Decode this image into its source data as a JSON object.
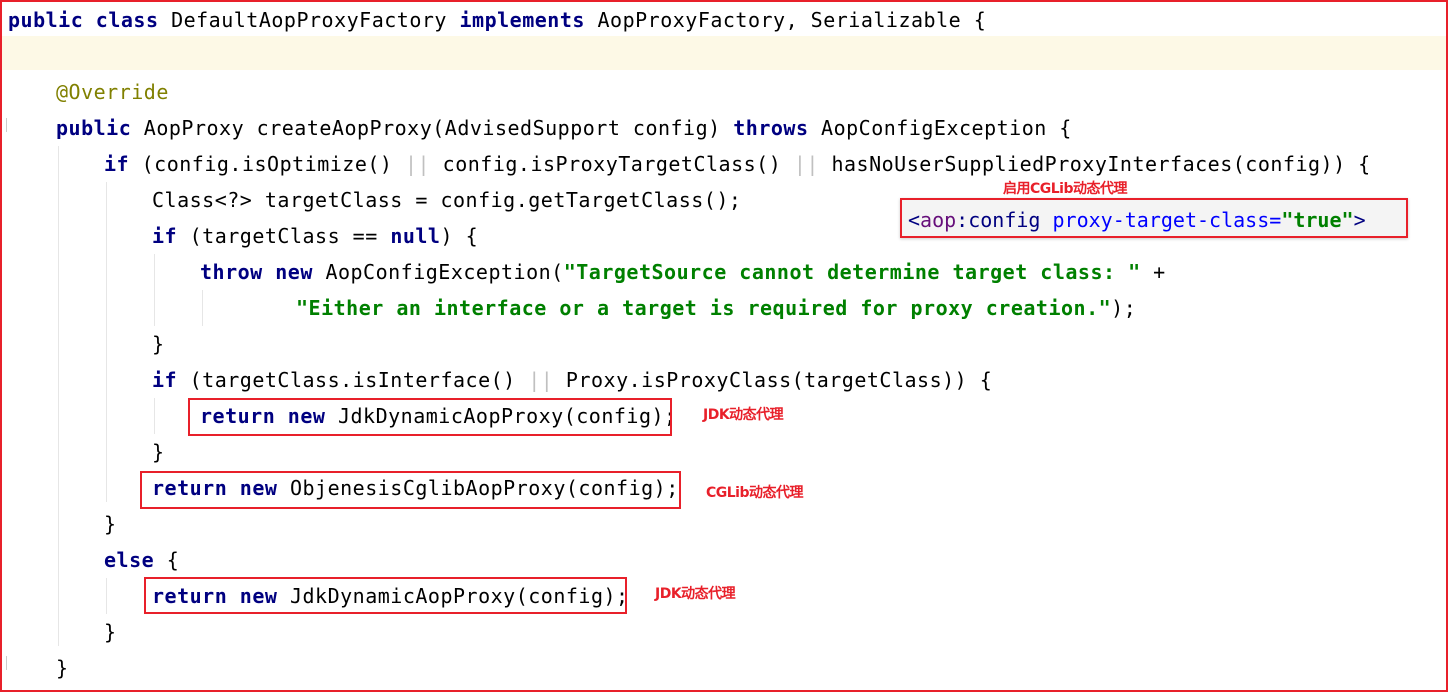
{
  "code": {
    "class_decl": {
      "kw1": "public",
      "kw2": "class",
      "name": "DefaultAopProxyFactory",
      "kw3": "implements",
      "rest": "AopProxyFactory, Serializable {"
    },
    "annotation": "@Override",
    "method_decl": {
      "kw": "public",
      "sig": "AopProxy createAopProxy(AdvisedSupport config)",
      "throws": "throws",
      "rest": "AopConfigException {"
    },
    "if1": {
      "kw": "if",
      "p1": "(config.isOptimize()",
      "p2": "config.isProxyTargetClass()",
      "p3": "hasNoUserSuppliedProxyInterfaces(config)) {",
      "or": "||"
    },
    "target_class": "Class<?> targetClass = config.getTargetClass();",
    "if2": {
      "kw": "if",
      "cond": "(targetClass ==",
      "null": "null",
      "rest": ") {"
    },
    "throw_line": {
      "kw1": "throw",
      "kw2": "new",
      "call": "AopConfigException(",
      "str": "\"TargetSource cannot determine target class: \"",
      "rest": " +"
    },
    "throw_line2": {
      "str": "\"Either an interface or a target is required for proxy creation.\"",
      "rest": ");"
    },
    "close_brace": "}",
    "if3": {
      "kw": "if",
      "p1": "(targetClass.isInterface()",
      "or": "||",
      "p2": "Proxy.isProxyClass(targetClass)) {"
    },
    "return_jdk": {
      "kw1": "return",
      "kw2": "new",
      "rest": "JdkDynamicAopProxy(config);"
    },
    "return_cglib": {
      "kw1": "return",
      "kw2": "new",
      "rest": "ObjenesisCglibAopProxy(config);"
    },
    "else": {
      "kw": "else",
      "rest": " {"
    }
  },
  "xml_snippet": {
    "open": "<",
    "ns": "aop",
    "colon": ":",
    "tag": "config",
    "attr": "proxy-target-class",
    "eq": "=",
    "value": "\"true\"",
    "close": ">"
  },
  "annotations": {
    "enable_cglib": "启用CGLib动态代理",
    "jdk_proxy_1": "JDK动态代理",
    "cglib_proxy": "CGLib动态代理",
    "jdk_proxy_2": "JDK动态代理"
  }
}
